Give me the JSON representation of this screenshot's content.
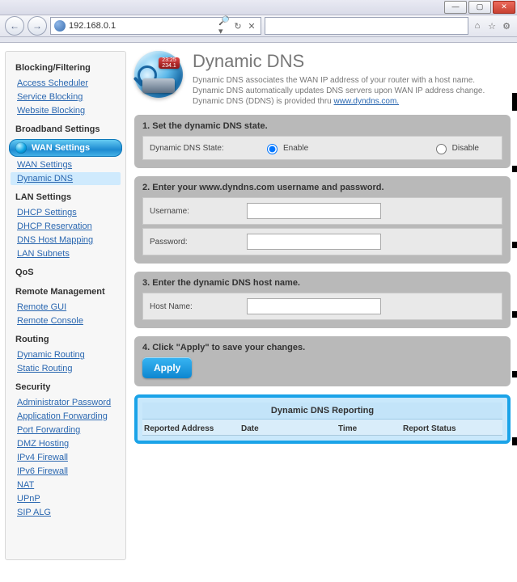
{
  "browser": {
    "url": "192.168.0.1",
    "win_min": "—",
    "win_max": "▢",
    "win_close": "✕",
    "back": "←",
    "fwd": "→",
    "search": "🔍",
    "refresh": "↻",
    "stop": "✕",
    "home": "⌂",
    "star": "☆",
    "gear": "⚙"
  },
  "sidebar": {
    "groups": [
      {
        "title": "Blocking/Filtering",
        "items": [
          "Access Scheduler",
          "Service Blocking",
          "Website Blocking"
        ]
      },
      {
        "title": "Broadband Settings",
        "items": []
      },
      {
        "title_active": "WAN Settings",
        "items": [
          "WAN Settings",
          "Dynamic DNS"
        ],
        "active_item_idx": 1
      },
      {
        "title": "LAN Settings",
        "items": [
          "DHCP Settings",
          "DHCP Reservation",
          "DNS Host Mapping",
          "LAN Subnets"
        ]
      },
      {
        "title": "QoS",
        "items": []
      },
      {
        "title": "Remote Management",
        "items": [
          "Remote GUI",
          "Remote Console"
        ]
      },
      {
        "title": "Routing",
        "items": [
          "Dynamic Routing",
          "Static Routing"
        ]
      },
      {
        "title": "Security",
        "items": [
          "Administrator Password",
          "Application Forwarding",
          "Port Forwarding",
          "DMZ Hosting",
          "IPv4 Firewall",
          "IPv6 Firewall",
          "NAT",
          "UPnP",
          "SIP ALG"
        ]
      }
    ]
  },
  "page": {
    "title": "Dynamic DNS",
    "desc1": "Dynamic DNS associates the WAN IP address of your router with a host name.",
    "desc2": "Dynamic DNS automatically updates DNS servers upon WAN IP address change.",
    "desc3_pre": "Dynamic DNS (DDNS) is provided thru ",
    "desc3_link": "www.dyndns.com.",
    "sections": {
      "s1_title": "1. Set the dynamic DNS state.",
      "state_label": "Dynamic DNS State:",
      "enable": "Enable",
      "disable": "Disable",
      "state_value": "enable",
      "s2_title": "2. Enter your www.dyndns.com username and password.",
      "user_label": "Username:",
      "pass_label": "Password:",
      "username": "",
      "password": "",
      "s3_title": "3. Enter the dynamic DNS host name.",
      "host_label": "Host Name:",
      "hostname": "",
      "s4_title": "4. Click \"Apply\" to save your changes.",
      "apply": "Apply"
    },
    "report": {
      "title": "Dynamic DNS Reporting",
      "cols": [
        "Reported Address",
        "Date",
        "Time",
        "Report Status"
      ]
    },
    "logo_badge": "23:25\n234.1"
  }
}
